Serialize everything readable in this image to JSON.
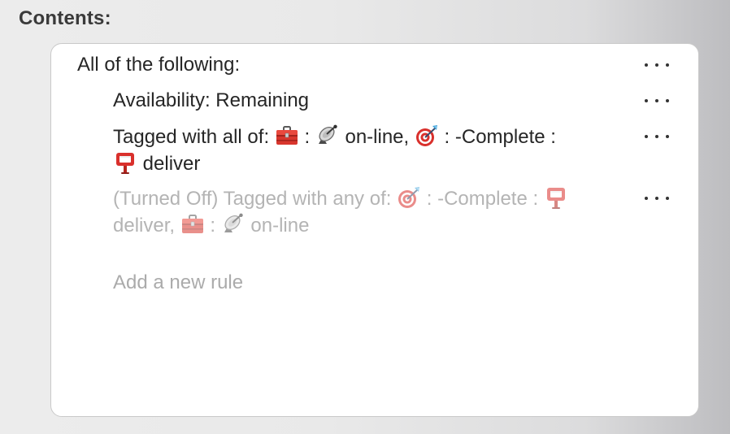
{
  "section": {
    "title": "Contents:"
  },
  "rules": {
    "root": {
      "label": "All of the following:"
    },
    "availability": {
      "label": "Availability: Remaining"
    },
    "tagged_all": {
      "prefix": "Tagged with all of:",
      "sep1": ":",
      "tag1": "on-line,",
      "sep2": ": -Complete :",
      "tag2": "deliver"
    },
    "tagged_any": {
      "prefix": "(Turned Off) Tagged with any of:",
      "sep1": ": -Complete :",
      "tag1": "deliver,",
      "sep2": ":",
      "tag2": "on-line",
      "enabled": false
    }
  },
  "add_rule": {
    "placeholder": "Add a new rule"
  },
  "icons": {
    "toolbox": "toolbox-icon",
    "satellite": "satellite-dish-icon",
    "target": "bullseye-target-icon",
    "postbox": "postbox-icon",
    "more": "more-options-icon"
  },
  "colors": {
    "text": "#262626",
    "disabled_text": "#b4b4b4",
    "placeholder": "#ababab",
    "panel": "#ffffff"
  }
}
